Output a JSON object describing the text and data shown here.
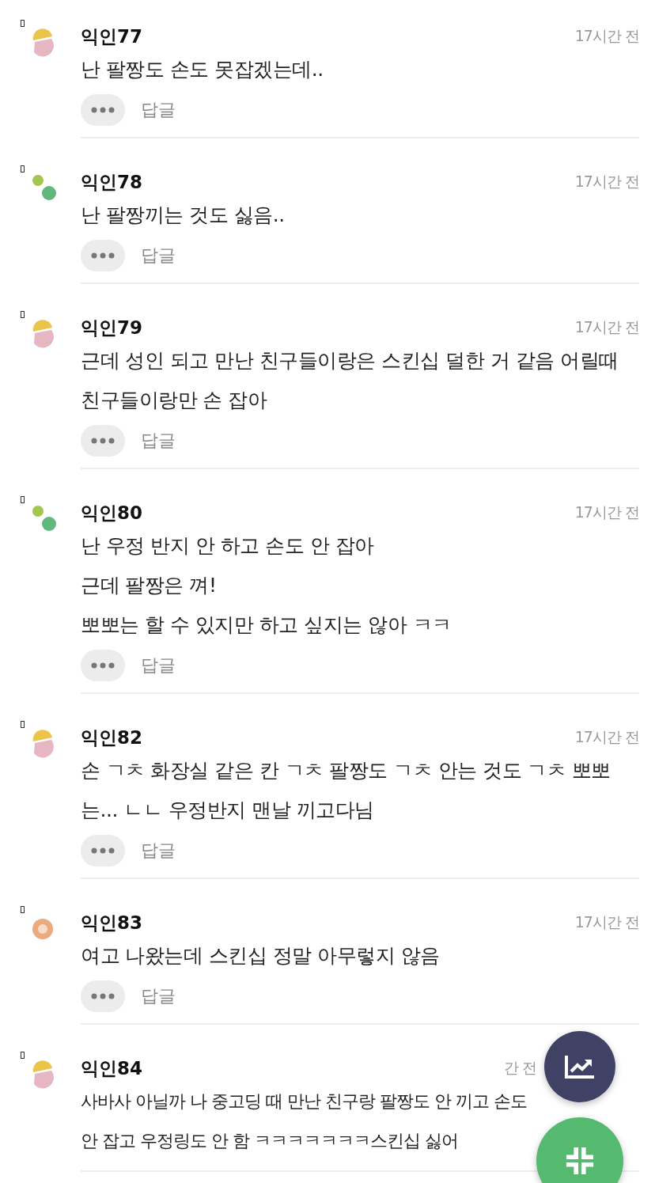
{
  "comments": [
    {
      "author": "익인77",
      "time": "17시간 전",
      "avatar": {
        "kind": "halves"
      },
      "lines": [
        "난 팔짱도 손도 못잡겠는데.."
      ],
      "reply": "답글"
    },
    {
      "author": "익인78",
      "time": "17시간 전",
      "avatar": {
        "kind": "dots"
      },
      "lines": [
        "난 팔짱끼는 것도 싫음.."
      ],
      "reply": "답글"
    },
    {
      "author": "익인79",
      "time": "17시간 전",
      "avatar": {
        "kind": "halves"
      },
      "lines": [
        "근데 성인 되고 만난 친구들이랑은 스킨십 덜한 거 같음 어릴때 친구들이랑만 손 잡아"
      ],
      "reply": "답글"
    },
    {
      "author": "익인80",
      "time": "17시간 전",
      "avatar": {
        "kind": "dots"
      },
      "lines": [
        "난 우정 반지 안 하고 손도 안 잡아",
        "근데 팔짱은 껴!",
        "뽀뽀는 할 수 있지만 하고 싶지는 않아 ㅋㅋ"
      ],
      "reply": "답글"
    },
    {
      "author": "익인82",
      "time": "17시간 전",
      "avatar": {
        "kind": "halves"
      },
      "lines": [
        "손 ㄱㅊ 화장실 같은 칸 ㄱㅊ 팔짱도 ㄱㅊ 안는 것도 ㄱㅊ 뽀뽀는... ㄴㄴ 우정반지 맨날 끼고다님"
      ],
      "reply": "답글"
    },
    {
      "author": "익인83",
      "time": "17시간 전",
      "avatar": {
        "kind": "ring"
      },
      "lines": [
        "여고 나왔는데 스킨십 정말 아무렇지 않음"
      ],
      "reply": "답글"
    },
    {
      "author": "익인84",
      "time": "간 전",
      "avatar": {
        "kind": "halves"
      },
      "lines": [
        "사바사 아닐까 나 중고딩 때 만난 친구랑 팔짱도 안 끼고 손도 안 잡고 우정링도 안 함 ㅋㅋㅋㅋㅋㅋㅋ스킨십 싫어"
      ]
    }
  ]
}
